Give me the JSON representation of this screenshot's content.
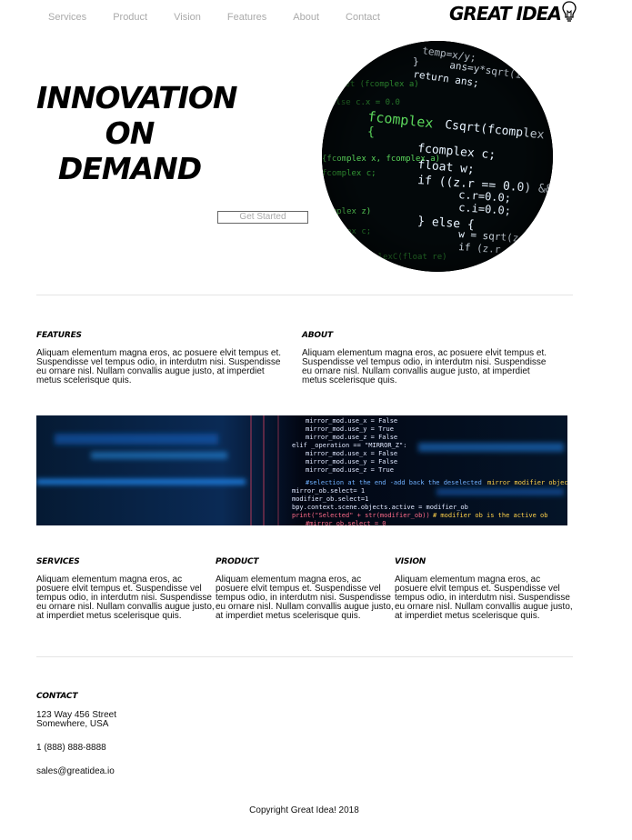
{
  "nav": {
    "items": [
      "Services",
      "Product",
      "Vision",
      "Features",
      "About",
      "Contact"
    ]
  },
  "logo": {
    "text": "GREAT IDEA"
  },
  "hero": {
    "title_lines": [
      "INNOVATION",
      "ON",
      "DEMAND"
    ],
    "button_label": "Get Started",
    "image_icon": "code-screen-image"
  },
  "sections": {
    "features": {
      "heading": "FEATURES",
      "body": "Aliquam elementum magna eros, ac posuere elvit tempus et. Suspendisse vel tempus odio, in interdutm nisi. Suspendisse eu ornare nisl. Nullam convallis augue justo, at imperdiet metus scelerisque quis."
    },
    "about": {
      "heading": "ABOUT",
      "body": "Aliquam elementum magna eros, ac posuere elvit tempus et. Suspendisse vel tempus odio, in interdutm nisi. Suspendisse eu ornare nisl. Nullam convallis augue justo, at imperdiet metus scelerisque quis."
    },
    "services": {
      "heading": "SERVICES",
      "body": "Aliquam elementum magna eros, ac posuere elvit tempus et. Suspendisse vel tempus odio, in interdutm nisi. Suspendisse eu ornare nisl. Nullam convallis augue justo, at imperdiet metus scelerisque quis."
    },
    "product": {
      "heading": "PRODUCT",
      "body": "Aliquam elementum magna eros, ac posuere elvit tempus et. Suspendisse vel tempus odio, in interdutm nisi. Suspendisse eu ornare nisl. Nullam convallis augue justo, at imperdiet metus scelerisque quis."
    },
    "vision": {
      "heading": "VISION",
      "body": "Aliquam elementum magna eros, ac posuere elvit tempus et. Suspendisse vel tempus odio, in interdutm nisi. Suspendisse eu ornare nisl. Nullam convallis augue justo, at imperdiet metus scelerisque quis."
    }
  },
  "contact": {
    "heading": "CONTACT",
    "address_line1": "123 Way 456 Street",
    "address_line2": "Somewhere, USA",
    "phone": "1 (888) 888-8888",
    "email": "sales@greatidea.io"
  },
  "footer": {
    "copyright": "Copyright Great Idea! 2018"
  },
  "colors": {
    "nav_text": "#aaaaaa",
    "code_green": "#5bd65b",
    "code_blue": "#1e90ff",
    "accent_black": "#000000"
  }
}
